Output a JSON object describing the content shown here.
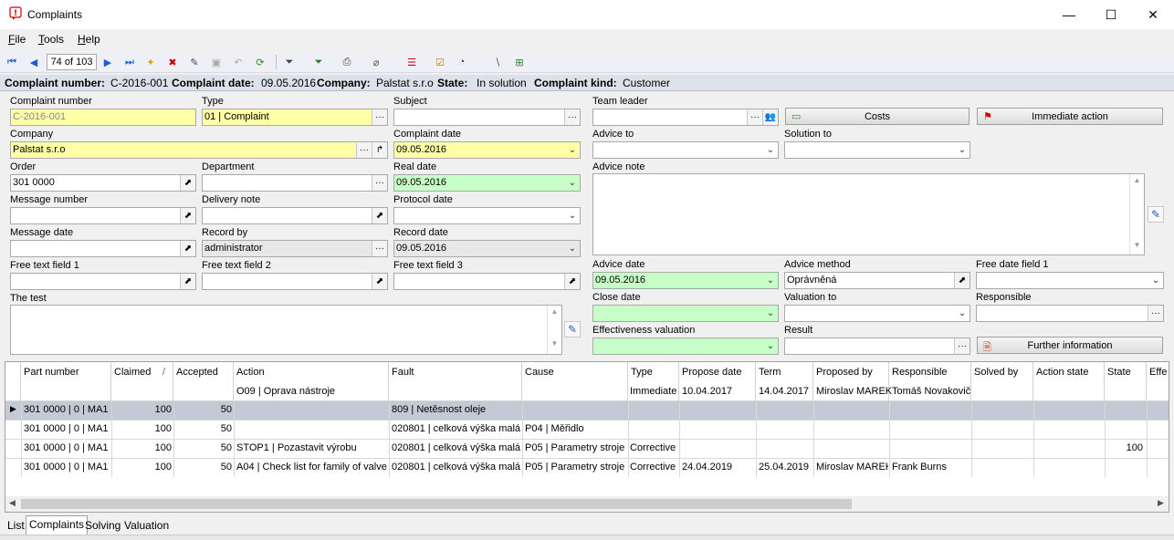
{
  "window": {
    "title": "Complaints",
    "minimize": "—",
    "maximize": "☐",
    "close": "✕"
  },
  "menu": [
    {
      "accel": "F",
      "rest": "ile"
    },
    {
      "accel": "T",
      "rest": "ools"
    },
    {
      "accel": "H",
      "rest": "elp"
    }
  ],
  "toolbar": {
    "record_counter": "74 of 103"
  },
  "infobar": {
    "complaint_number_label": "Complaint number:",
    "complaint_number": "C-2016-001",
    "complaint_date_label": "Complaint date:",
    "complaint_date": "09.05.2016",
    "company_label": "Company:",
    "company": "Palstat s.r.o",
    "state_label": "State:",
    "state": "In solution",
    "kind_label": "Complaint kind:",
    "kind": "Customer"
  },
  "form": {
    "complaint_number": {
      "label": "Complaint number",
      "value": "C-2016-001"
    },
    "type": {
      "label": "Type",
      "value": "01 | Complaint"
    },
    "subject": {
      "label": "Subject",
      "value": ""
    },
    "company": {
      "label": "Company",
      "value": "Palstat s.r.o"
    },
    "complaint_date": {
      "label": "Complaint date",
      "value": "09.05.2016"
    },
    "order": {
      "label": "Order",
      "value": "301 0000"
    },
    "department": {
      "label": "Department",
      "value": ""
    },
    "real_date": {
      "label": "Real date",
      "value": "09.05.2016"
    },
    "message_number": {
      "label": "Message number",
      "value": ""
    },
    "delivery_note": {
      "label": "Delivery note",
      "value": ""
    },
    "protocol_date": {
      "label": "Protocol date",
      "value": ""
    },
    "message_date": {
      "label": "Message date",
      "value": ""
    },
    "record_by": {
      "label": "Record by",
      "value": "administrator"
    },
    "record_date": {
      "label": "Record date",
      "value": "09.05.2016"
    },
    "free_text_1": {
      "label": "Free text field 1",
      "value": ""
    },
    "free_text_2": {
      "label": "Free text field 2",
      "value": ""
    },
    "free_text_3": {
      "label": "Free text field 3",
      "value": ""
    },
    "the_test": {
      "label": "The test",
      "value": ""
    },
    "team_leader": {
      "label": "Team leader",
      "value": ""
    },
    "costs_button": "Costs",
    "immediate_action_button": "Immediate action",
    "advice_to": {
      "label": "Advice to",
      "value": ""
    },
    "solution_to": {
      "label": "Solution to",
      "value": ""
    },
    "advice_note": {
      "label": "Advice note",
      "value": ""
    },
    "advice_date": {
      "label": "Advice date",
      "value": "09.05.2016"
    },
    "advice_method": {
      "label": "Advice method",
      "value": "Oprávněná"
    },
    "free_date_1": {
      "label": "Free date field 1",
      "value": ""
    },
    "close_date": {
      "label": "Close date",
      "value": ""
    },
    "valuation_to": {
      "label": "Valuation to",
      "value": ""
    },
    "responsible": {
      "label": "Responsible",
      "value": ""
    },
    "effectiveness_valuation": {
      "label": "Effectiveness valuation",
      "value": ""
    },
    "result": {
      "label": "Result",
      "value": ""
    },
    "further_info_button": "Further information"
  },
  "grid": {
    "columns": [
      "Part number",
      "Claimed",
      "Accepted",
      "Action",
      "Fault",
      "Cause",
      "Type",
      "Propose date",
      "Term",
      "Proposed by",
      "Responsible",
      "Solved by",
      "Action state",
      "State",
      "Effe"
    ],
    "sort_indicator": "/",
    "subheader": {
      "action": "O09 | Oprava nástroje",
      "type": "Immediate",
      "propose_date": "10.04.2017",
      "term": "14.04.2017",
      "proposed_by": "Miroslav MAREK",
      "responsible": "Tomáš Novakovič"
    },
    "rows": [
      {
        "part": "301 0000 | 0 | MA1",
        "claimed": "100",
        "accepted": "50",
        "action": "",
        "fault": "809 | Netěsnost oleje",
        "cause": "",
        "type": "",
        "propose_date": "",
        "term": "",
        "proposed_by": "",
        "responsible": "",
        "solved_by": "",
        "action_state": "",
        "state": ""
      },
      {
        "part": "301 0000 | 0 | MA1",
        "claimed": "100",
        "accepted": "50",
        "action": "",
        "fault": "020801 | celková výška malá",
        "cause": "P04 | Měřidlo",
        "type": "",
        "propose_date": "",
        "term": "",
        "proposed_by": "",
        "responsible": "",
        "solved_by": "",
        "action_state": "",
        "state": ""
      },
      {
        "part": "301 0000 | 0 | MA1",
        "claimed": "100",
        "accepted": "50",
        "action": "STOP1 | Pozastavit výrobu",
        "fault": "020801 | celková výška malá",
        "cause": "P05 | Parametry stroje",
        "type": "Corrective",
        "propose_date": "",
        "term": "",
        "proposed_by": "",
        "responsible": "",
        "solved_by": "",
        "action_state": "",
        "state": "100"
      },
      {
        "part": "301 0000 | 0 | MA1",
        "claimed": "100",
        "accepted": "50",
        "action": "A04 | Check list for family of valve",
        "fault": "020801 | celková výška malá",
        "cause": "P05 | Parametry stroje",
        "type": "Corrective",
        "propose_date": "24.04.2019",
        "term": "25.04.2019",
        "proposed_by": "Miroslav MAREK",
        "responsible": "Frank Burns",
        "solved_by": "",
        "action_state": "",
        "state": ""
      }
    ]
  },
  "tabs": [
    "List",
    "Complaints",
    "Solving",
    "Valuation"
  ],
  "active_tab": "Complaints"
}
